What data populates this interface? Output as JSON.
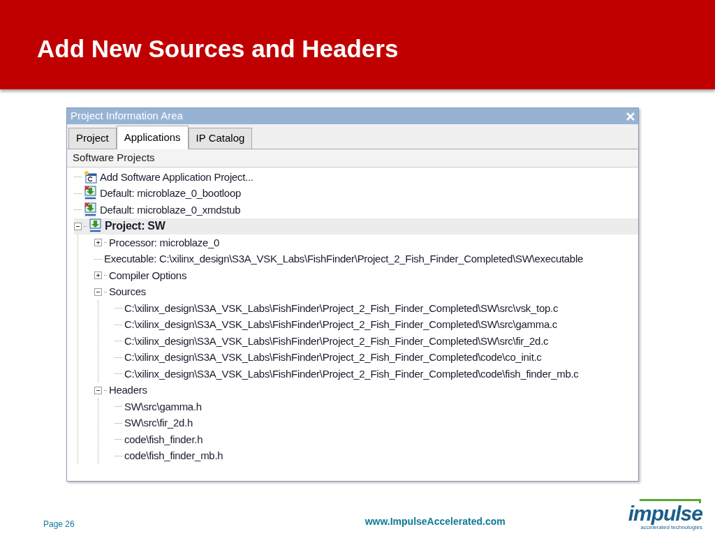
{
  "slide": {
    "title": "Add New Sources and Headers"
  },
  "window": {
    "title": "Project Information Area",
    "tabs": [
      {
        "label": "Project",
        "selected": false
      },
      {
        "label": "Applications",
        "selected": true
      },
      {
        "label": "IP Catalog",
        "selected": false
      }
    ],
    "section_header": "Software Projects",
    "tree": [
      {
        "label": "Add Software Application Project...",
        "kind": "add",
        "selected": false
      },
      {
        "label": "Default: microblaze_0_bootloop",
        "kind": "default_app",
        "selected": false
      },
      {
        "label": "Default: microblaze_0_xmdstub",
        "kind": "default_app",
        "selected": false
      },
      {
        "label": "Project: SW",
        "kind": "project",
        "selected": true,
        "expanded": true,
        "children": [
          {
            "label": "Processor: microblaze_0",
            "expanded": false
          },
          {
            "label": "Executable: C:\\xilinx_design\\S3A_VSK_Labs\\FishFinder\\Project_2_Fish_Finder_Completed\\SW\\executable"
          },
          {
            "label": "Compiler Options",
            "expanded": false
          },
          {
            "label": "Sources",
            "expanded": true,
            "children": [
              {
                "label": "C:\\xilinx_design\\S3A_VSK_Labs\\FishFinder\\Project_2_Fish_Finder_Completed\\SW\\src\\vsk_top.c"
              },
              {
                "label": "C:\\xilinx_design\\S3A_VSK_Labs\\FishFinder\\Project_2_Fish_Finder_Completed\\SW\\src\\gamma.c"
              },
              {
                "label": "C:\\xilinx_design\\S3A_VSK_Labs\\FishFinder\\Project_2_Fish_Finder_Completed\\SW\\src\\fir_2d.c"
              },
              {
                "label": "C:\\xilinx_design\\S3A_VSK_Labs\\FishFinder\\Project_2_Fish_Finder_Completed\\code\\co_init.c"
              },
              {
                "label": "C:\\xilinx_design\\S3A_VSK_Labs\\FishFinder\\Project_2_Fish_Finder_Completed\\code\\fish_finder_mb.c"
              }
            ]
          },
          {
            "label": "Headers",
            "expanded": true,
            "children": [
              {
                "label": "SW\\src\\gamma.h"
              },
              {
                "label": "SW\\src\\fir_2d.h"
              },
              {
                "label": "code\\fish_finder.h"
              },
              {
                "label": "code\\fish_finder_mb.h"
              }
            ]
          }
        ]
      }
    ]
  },
  "footer": {
    "page": "Page 26",
    "url": "www.ImpulseAccelerated.com",
    "logo": {
      "name": "impulse",
      "tagline": "accelerated technologies"
    }
  }
}
